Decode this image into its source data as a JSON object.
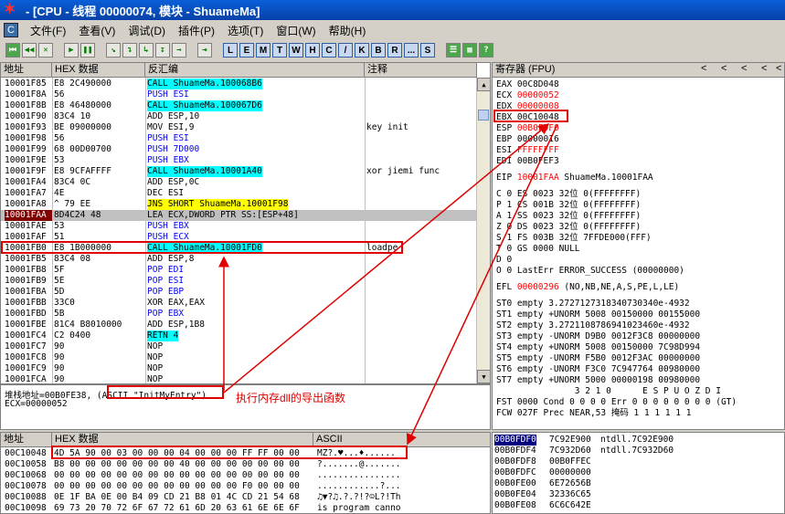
{
  "window": {
    "title": "- [CPU - 线程 00000074, 模块 - ShuameMa]"
  },
  "menu": [
    "文件(F)",
    "查看(V)",
    "调试(D)",
    "插件(P)",
    "选项(T)",
    "窗口(W)",
    "帮助(H)"
  ],
  "toolbar": {
    "nav": [
      "⏮",
      "◀◀",
      "✕",
      "▶",
      "❚❚",
      "↘",
      "↴",
      "↳",
      "↧",
      "→",
      "⇥"
    ],
    "letters": [
      "L",
      "E",
      "M",
      "T",
      "W",
      "H",
      "C",
      "/",
      "K",
      "B",
      "R",
      "...",
      "S"
    ]
  },
  "disasm": {
    "headers": {
      "addr": "地址",
      "hex": "HEX 数据",
      "asm": "反汇编",
      "comment": "注释"
    },
    "rows": [
      {
        "addr": "10001F85",
        "hex": "E8 2C490000",
        "asm": "CALL ShuameMa.100068B6",
        "cmt": "",
        "kind": "call"
      },
      {
        "addr": "10001F8A",
        "hex": "56",
        "asm": "PUSH ESI",
        "cmt": "",
        "kind": "push"
      },
      {
        "addr": "10001F8B",
        "hex": "E8 46480000",
        "asm": "CALL ShuameMa.100067D6",
        "cmt": "",
        "kind": "call"
      },
      {
        "addr": "10001F90",
        "hex": "83C4 10",
        "asm": "ADD ESP,10",
        "cmt": "",
        "kind": ""
      },
      {
        "addr": "10001F93",
        "hex": "BE 09000000",
        "asm": "MOV ESI,9",
        "cmt": "key init",
        "kind": ""
      },
      {
        "addr": "10001F98",
        "hex": "56",
        "asm": "PUSH ESI",
        "cmt": "",
        "kind": "push"
      },
      {
        "addr": "10001F99",
        "hex": "68 00D00700",
        "asm": "PUSH 7D000",
        "cmt": "",
        "kind": "push"
      },
      {
        "addr": "10001F9E",
        "hex": "53",
        "asm": "PUSH EBX",
        "cmt": "",
        "kind": "push"
      },
      {
        "addr": "10001F9F",
        "hex": "E8 9CFAFFFF",
        "asm": "CALL ShuameMa.10001A40",
        "cmt": "xor jiemi func",
        "kind": "call"
      },
      {
        "addr": "10001FA4",
        "hex": "83C4 0C",
        "asm": "ADD ESP,0C",
        "cmt": "",
        "kind": ""
      },
      {
        "addr": "10001FA7",
        "hex": "4E",
        "asm": "DEC ESI",
        "cmt": "",
        "kind": ""
      },
      {
        "addr": "10001FA8",
        "hex": "^ 79 EE",
        "asm": "JNS SHORT ShuameMa.10001F98",
        "cmt": "",
        "kind": "jmp"
      },
      {
        "addr": "10001FAA",
        "hex": "8D4C24 48",
        "asm": "LEA ECX,DWORD PTR SS:[ESP+48]",
        "cmt": "",
        "kind": "cur"
      },
      {
        "addr": "10001FAE",
        "hex": "53",
        "asm": "PUSH EBX",
        "cmt": "",
        "kind": "push"
      },
      {
        "addr": "10001FAF",
        "hex": "51",
        "asm": "PUSH ECX",
        "cmt": "",
        "kind": "push"
      },
      {
        "addr": "10001FB0",
        "hex": "E8 1B000000",
        "asm": "CALL ShuameMa.10001FD0",
        "cmt": "loadpe",
        "kind": "call"
      },
      {
        "addr": "10001FB5",
        "hex": "83C4 08",
        "asm": "ADD ESP,8",
        "cmt": "",
        "kind": ""
      },
      {
        "addr": "10001FB8",
        "hex": "5F",
        "asm": "POP EDI",
        "cmt": "",
        "kind": "push"
      },
      {
        "addr": "10001FB9",
        "hex": "5E",
        "asm": "POP ESI",
        "cmt": "",
        "kind": "push"
      },
      {
        "addr": "10001FBA",
        "hex": "5D",
        "asm": "POP EBP",
        "cmt": "",
        "kind": "push"
      },
      {
        "addr": "10001FBB",
        "hex": "33C0",
        "asm": "XOR EAX,EAX",
        "cmt": "",
        "kind": ""
      },
      {
        "addr": "10001FBD",
        "hex": "5B",
        "asm": "POP EBX",
        "cmt": "",
        "kind": "push"
      },
      {
        "addr": "10001FBE",
        "hex": "81C4 B8010000",
        "asm": "ADD ESP,1B8",
        "cmt": "",
        "kind": ""
      },
      {
        "addr": "10001FC4",
        "hex": "C2 0400",
        "asm": "RETN 4",
        "cmt": "",
        "kind": "ret"
      },
      {
        "addr": "10001FC7",
        "hex": "90",
        "asm": "NOP",
        "cmt": "",
        "kind": ""
      },
      {
        "addr": "10001FC8",
        "hex": "90",
        "asm": "NOP",
        "cmt": "",
        "kind": ""
      },
      {
        "addr": "10001FC9",
        "hex": "90",
        "asm": "NOP",
        "cmt": "",
        "kind": ""
      },
      {
        "addr": "10001FCA",
        "hex": "90",
        "asm": "NOP",
        "cmt": "",
        "kind": ""
      }
    ]
  },
  "info": {
    "line1": "堆栈地址=00B0FE38, ",
    "line1_ascii": "(ASCII \"InitMyEntry\")",
    "line2": "ECX=00000052",
    "annotation": "执行内存dll的导出函数"
  },
  "registers": {
    "header": "寄存器 (FPU)",
    "arrows": [
      "<",
      "<",
      "<",
      "<",
      "<"
    ],
    "gp": [
      {
        "name": "EAX",
        "val": "00C8D048",
        "red": false
      },
      {
        "name": "ECX",
        "val": "00000052",
        "red": true
      },
      {
        "name": "EDX",
        "val": "00000008",
        "red": true
      },
      {
        "name": "EBX",
        "val": "00C10048",
        "red": false
      },
      {
        "name": "ESP",
        "val": "00B0FDF0",
        "red": true
      },
      {
        "name": "EBP",
        "val": "00000016",
        "red": false
      },
      {
        "name": "ESI",
        "val": "FFFFFFFF",
        "red": true
      },
      {
        "name": "EDI",
        "val": "00B0FEF3",
        "red": false
      }
    ],
    "eip": {
      "name": "EIP",
      "val": "10001FAA",
      "sym": "ShuameMa.10001FAA"
    },
    "seg": [
      "C 0  ES 0023 32位 0(FFFFFFFF)",
      "P 1  CS 001B 32位 0(FFFFFFFF)",
      "A 1  SS 0023 32位 0(FFFFFFFF)",
      "Z 0  DS 0023 32位 0(FFFFFFFF)",
      "S 1  FS 003B 32位 7FFDE000(FFF)",
      "T 0  GS 0000 NULL",
      "D 0",
      "O 0  LastErr ERROR_SUCCESS (00000000)"
    ],
    "efl": {
      "name": "EFL",
      "val": "00000296",
      "desc": "(NO,NB,NE,A,S,PE,L,LE)"
    },
    "fpu": [
      "ST0 empty 3.2727127318340730340e-4932",
      "ST1 empty +UNORM 5008 00150000 00155000",
      "ST2 empty 3.2721108786941023460e-4932",
      "ST3 empty -UNORM D9B0 0012F3C8 00000000",
      "ST4 empty +UNORM 5008 00150000 7C98D994",
      "ST5 empty -UNORM F5B0 0012F3AC 00000000",
      "ST6 empty -UNORM F3C0 7C947764 00980000",
      "ST7 empty +UNORM 5000 00000198 00980000"
    ],
    "fst_hdr": "               3 2 1 0      E S P U O Z D I",
    "fst": "FST 0000  Cond 0 0 0 0  Err 0 0 0 0 0 0 0 0  (GT)",
    "fcw": "FCW 027F  Prec NEAR,53  掩码    1 1 1 1 1 1"
  },
  "dump": {
    "headers": {
      "addr": "地址",
      "hex": "HEX 数据",
      "ascii": "ASCII"
    },
    "rows": [
      {
        "addr": "00C10048",
        "hex": "4D 5A 90 00 03 00 00 00 04 00 00 00 FF FF 00 00",
        "ascii": "MZ?.♥...♦......"
      },
      {
        "addr": "00C10058",
        "hex": "B8 00 00 00 00 00 00 00 40 00 00 00 00 00 00 00",
        "ascii": "?.......@......."
      },
      {
        "addr": "00C10068",
        "hex": "00 00 00 00 00 00 00 00 00 00 00 00 00 00 00 00",
        "ascii": "................"
      },
      {
        "addr": "00C10078",
        "hex": "00 00 00 00 00 00 00 00 00 00 00 00 F0 00 00 00",
        "ascii": "............?..."
      },
      {
        "addr": "00C10088",
        "hex": "0E 1F BA 0E 00 B4 09 CD 21 B8 01 4C CD 21 54 68",
        "ascii": "♫▼?♫.?.?!?☺L?!Th"
      },
      {
        "addr": "00C10098",
        "hex": "69 73 20 70 72 6F 67 72 61 6D 20 63 61 6E 6E 6F",
        "ascii": "is program canno"
      }
    ]
  },
  "stack": {
    "rows": [
      {
        "addr": "00B0FDF0",
        "val": "7C92E900",
        "cmt": "ntdll.7C92E900",
        "cur": true
      },
      {
        "addr": "00B0FDF4",
        "val": "7C932D60",
        "cmt": "ntdll.7C932D60",
        "cur": false
      },
      {
        "addr": "00B0FDF8",
        "val": "00B0FFEC",
        "cmt": "",
        "cur": false
      },
      {
        "addr": "00B0FDFC",
        "val": "00000000",
        "cmt": "",
        "cur": false
      },
      {
        "addr": "00B0FE00",
        "val": "6E72656B",
        "cmt": "",
        "cur": false
      },
      {
        "addr": "00B0FE04",
        "val": "32336C65",
        "cmt": "",
        "cur": false
      },
      {
        "addr": "00B0FE08",
        "val": "6C6C642E",
        "cmt": "",
        "cur": false
      }
    ]
  }
}
